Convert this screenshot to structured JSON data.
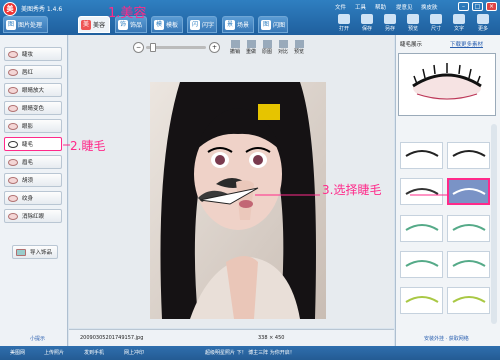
{
  "app": {
    "title": "美图秀秀 1.4.6"
  },
  "menu": [
    "文件",
    "工具",
    "帮助",
    "提意见",
    "换皮肤"
  ],
  "tabs": [
    {
      "label": "图片处理",
      "icon": "图"
    },
    {
      "label": "美容",
      "icon": "美"
    },
    {
      "label": "饰品",
      "icon": "饰"
    },
    {
      "label": "模板",
      "icon": "模"
    },
    {
      "label": "闪字",
      "icon": "闪"
    },
    {
      "label": "场景",
      "icon": "景"
    },
    {
      "label": "闪图",
      "icon": "图"
    }
  ],
  "toolbar": [
    "打开",
    "保存",
    "另存",
    "预览",
    "尺寸",
    "文字",
    "更多"
  ],
  "canvas_tools": {
    "buttons": [
      "撤销",
      "重做",
      "原图",
      "对比",
      "预览"
    ]
  },
  "left_panel": {
    "items": [
      "睫妆",
      "唇红",
      "眼睛放大",
      "眼睛变色",
      "眼影",
      "睫毛",
      "眉毛",
      "胡须",
      "纹身",
      "消除红眼"
    ],
    "selected_index": 5,
    "import_button": "导入饰品",
    "footer_link": "小提示"
  },
  "status": {
    "filename": "20090305201749157.jpg",
    "dimensions": "338 × 450"
  },
  "right_panel": {
    "header": "睫毛展示",
    "link": "下载更多素材",
    "footer_link": "安装外挂 · 获取网络"
  },
  "bottom_bar": {
    "items": [
      "美图网",
      "上传照片",
      "发到手机",
      "网上冲印"
    ],
    "center": "超级明星照片 下！ 博主三阵 为你开启！"
  },
  "annotations": {
    "a1": "1.美容",
    "a2": "2.睫毛",
    "a3": "3.选择睫毛"
  },
  "colors": {
    "annotation": "#ff2a8a",
    "chrome": "#2f7fc1"
  }
}
